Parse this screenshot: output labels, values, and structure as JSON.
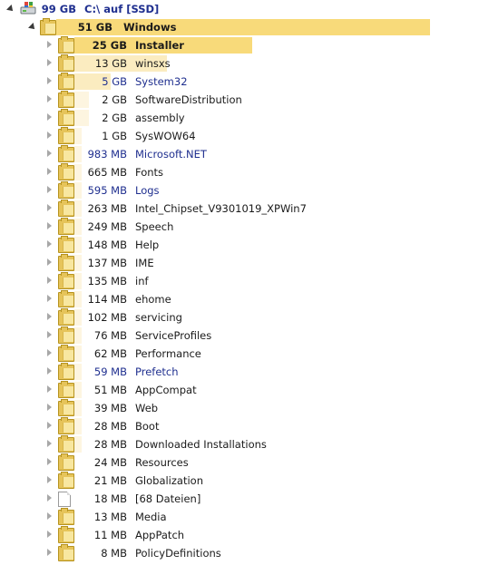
{
  "drive": {
    "size": "99 GB",
    "name": "C:\\ auf  [SSD]",
    "icon": "drive-icon",
    "title_color": "#1f2f8f"
  },
  "colors": {
    "bar_strong": "#f8da7a",
    "bar_light": "#fbecc0",
    "bar_faint": "#fdf5e0",
    "hidden_blue": "#1f2f8f"
  },
  "rows": [
    {
      "size": "51 GB",
      "name": "Windows",
      "icon": "folder-icon",
      "bold": true,
      "share": 0.515,
      "toggle": "expanded"
    },
    {
      "size": "25 GB",
      "name": "Installer",
      "icon": "folder-icon",
      "bold": true,
      "share": 0.49
    },
    {
      "size": "13 GB",
      "name": "winsxs",
      "icon": "folder-icon",
      "share": 0.255
    },
    {
      "size": "5 GB",
      "name": "System32",
      "icon": "folder-icon",
      "hidden": true,
      "share": 0.1
    },
    {
      "size": "2 GB",
      "name": "SoftwareDistribution",
      "icon": "folder-icon",
      "share": 0.04
    },
    {
      "size": "2 GB",
      "name": "assembly",
      "icon": "folder-icon",
      "share": 0.04
    },
    {
      "size": "1 GB",
      "name": "SysWOW64",
      "icon": "folder-icon",
      "share": 0.02
    },
    {
      "size": "983 MB",
      "name": "Microsoft.NET",
      "icon": "folder-icon",
      "hidden": true,
      "share": 0.019
    },
    {
      "size": "665 MB",
      "name": "Fonts",
      "icon": "folder-icon",
      "share": 0.013
    },
    {
      "size": "595 MB",
      "name": "Logs",
      "icon": "folder-icon",
      "hidden": true,
      "share": 0.011
    },
    {
      "size": "263 MB",
      "name": "Intel_Chipset_V9301019_XPWin7",
      "icon": "folder-icon",
      "share": 0.005
    },
    {
      "size": "249 MB",
      "name": "Speech",
      "icon": "folder-icon",
      "share": 0.005
    },
    {
      "size": "148 MB",
      "name": "Help",
      "icon": "folder-icon",
      "share": 0.003
    },
    {
      "size": "137 MB",
      "name": "IME",
      "icon": "folder-icon",
      "share": 0.003
    },
    {
      "size": "135 MB",
      "name": "inf",
      "icon": "folder-icon",
      "share": 0.003
    },
    {
      "size": "114 MB",
      "name": "ehome",
      "icon": "folder-icon",
      "share": 0.002
    },
    {
      "size": "102 MB",
      "name": "servicing",
      "icon": "folder-icon",
      "share": 0.002
    },
    {
      "size": "76 MB",
      "name": "ServiceProfiles",
      "icon": "folder-icon",
      "share": 0.001
    },
    {
      "size": "62 MB",
      "name": "Performance",
      "icon": "folder-icon",
      "share": 0.001
    },
    {
      "size": "59 MB",
      "name": "Prefetch",
      "icon": "folder-icon",
      "hidden": true,
      "share": 0.001
    },
    {
      "size": "51 MB",
      "name": "AppCompat",
      "icon": "folder-icon",
      "share": 0.001
    },
    {
      "size": "39 MB",
      "name": "Web",
      "icon": "folder-icon",
      "share": 0.001
    },
    {
      "size": "28 MB",
      "name": "Boot",
      "icon": "folder-icon",
      "share": 0.001
    },
    {
      "size": "28 MB",
      "name": "Downloaded Installations",
      "icon": "folder-icon",
      "share": 0.001
    },
    {
      "size": "24 MB",
      "name": "Resources",
      "icon": "folder-icon",
      "share": 0.0
    },
    {
      "size": "21 MB",
      "name": "Globalization",
      "icon": "folder-icon",
      "share": 0.0
    },
    {
      "size": "18 MB",
      "name": "[68 Dateien]",
      "icon": "file-icon",
      "share": 0.0
    },
    {
      "size": "13 MB",
      "name": "Media",
      "icon": "folder-icon",
      "share": 0.0
    },
    {
      "size": "11 MB",
      "name": "AppPatch",
      "icon": "folder-icon",
      "share": 0.0
    },
    {
      "size": "8 MB",
      "name": "PolicyDefinitions",
      "icon": "folder-icon",
      "share": 0.0
    }
  ]
}
